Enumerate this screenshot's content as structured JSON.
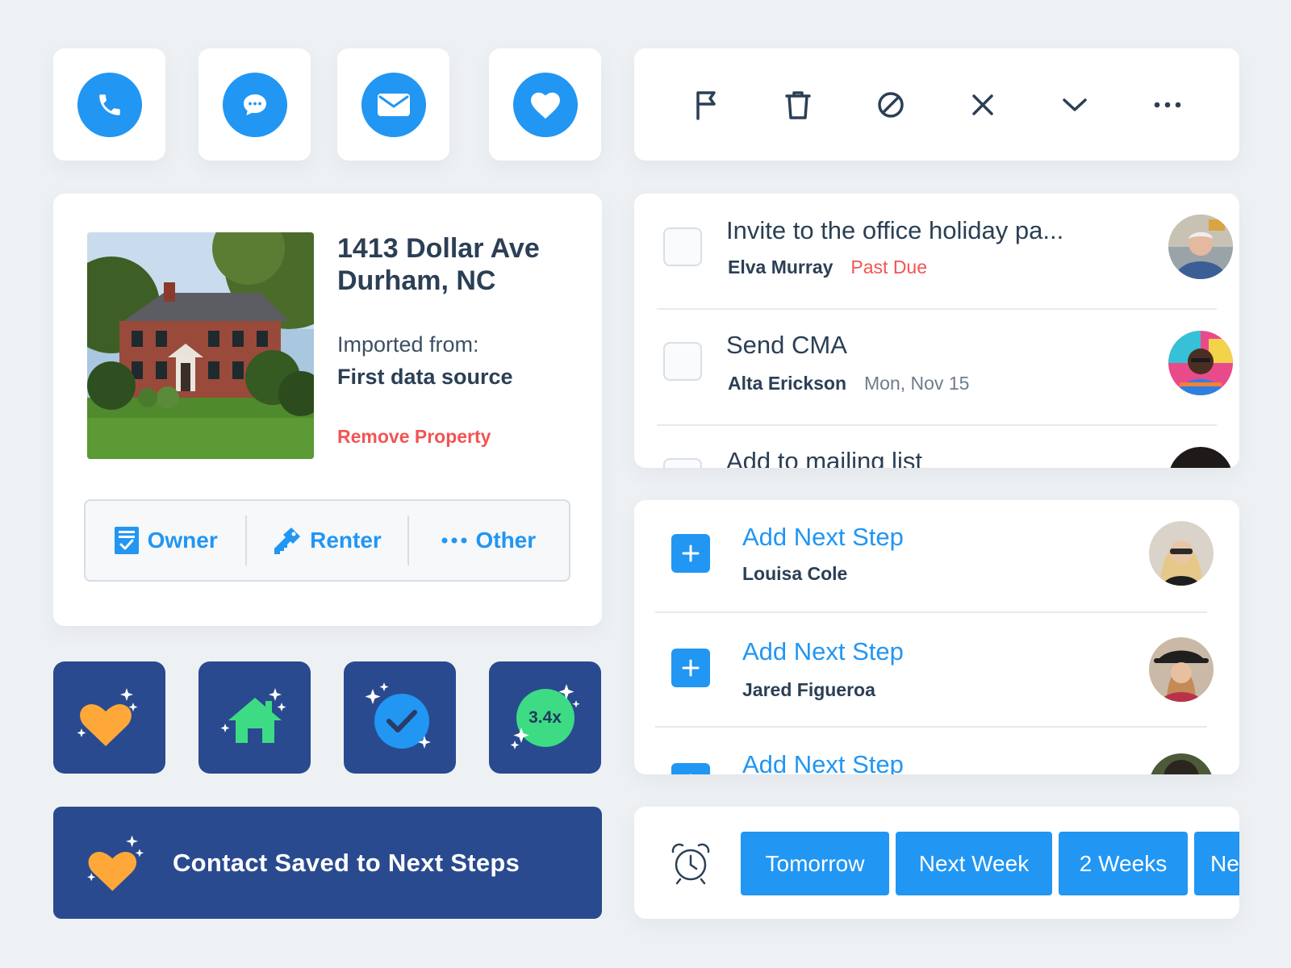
{
  "actions": {
    "call_icon": "phone-icon",
    "message_icon": "chat-bubble-icon",
    "email_icon": "envelope-icon",
    "favorite_icon": "heart-icon"
  },
  "toolbar": {
    "icons": [
      "flag-icon",
      "trash-icon",
      "block-icon",
      "close-icon",
      "chevron-down-icon",
      "more-icon"
    ]
  },
  "property": {
    "address_line1": "1413 Dollar Ave",
    "address_line2": "Durham, NC",
    "imported_label": "Imported from:",
    "source": "First data source",
    "remove_label": "Remove Property",
    "roles": [
      {
        "label": "Owner",
        "icon": "document-check-icon"
      },
      {
        "label": "Renter",
        "icon": "key-icon"
      },
      {
        "label": "Other",
        "icon": "more-icon"
      }
    ]
  },
  "badges": {
    "multiplier": "3.4x"
  },
  "banner": {
    "text": "Contact Saved to Next Steps"
  },
  "tasks": [
    {
      "title": "Invite to the office holiday pa...",
      "person": "Elva Murray",
      "extra": "Past Due",
      "extra_color": "#f25454"
    },
    {
      "title": "Send CMA",
      "person": "Alta Erickson",
      "extra": "Mon, Nov 15",
      "extra_color": "#6d7c8c"
    },
    {
      "title": "Add to mailing list",
      "person": "",
      "extra": "",
      "extra_color": "#6d7c8c"
    }
  ],
  "next_steps": [
    {
      "title": "Add Next Step",
      "person": "Louisa Cole"
    },
    {
      "title": "Add Next Step",
      "person": "Jared Figueroa"
    },
    {
      "title": "Add Next Step",
      "person": ""
    }
  ],
  "snooze": {
    "icon": "alarm-clock-icon",
    "options": [
      "Tomorrow",
      "Next Week",
      "2 Weeks",
      "Ne"
    ]
  },
  "colors": {
    "accent": "#2196f3",
    "danger": "#f25454",
    "navy": "#2a4a8f",
    "gold": "#ffa83a",
    "green": "#3ddc84"
  }
}
